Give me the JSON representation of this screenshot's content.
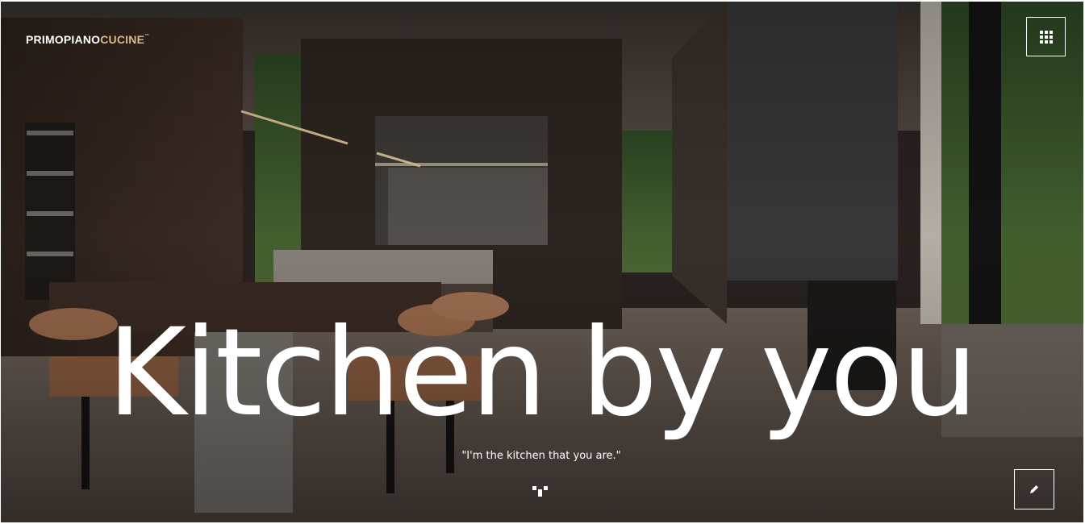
{
  "header": {
    "logo_primary": "PRIMOPIANO",
    "logo_accent": "CUCINE",
    "logo_trademark": "™",
    "menu_icon": "grid-dots-icon"
  },
  "hero": {
    "headline": "Kitchen by you",
    "tagline": "\"I'm the kitchen that you are.\"",
    "scroll_icon": "chevron-down-icon",
    "edit_icon": "pencil-icon"
  },
  "colors": {
    "text": "#ffffff",
    "logo_accent": "#d8b98a"
  }
}
